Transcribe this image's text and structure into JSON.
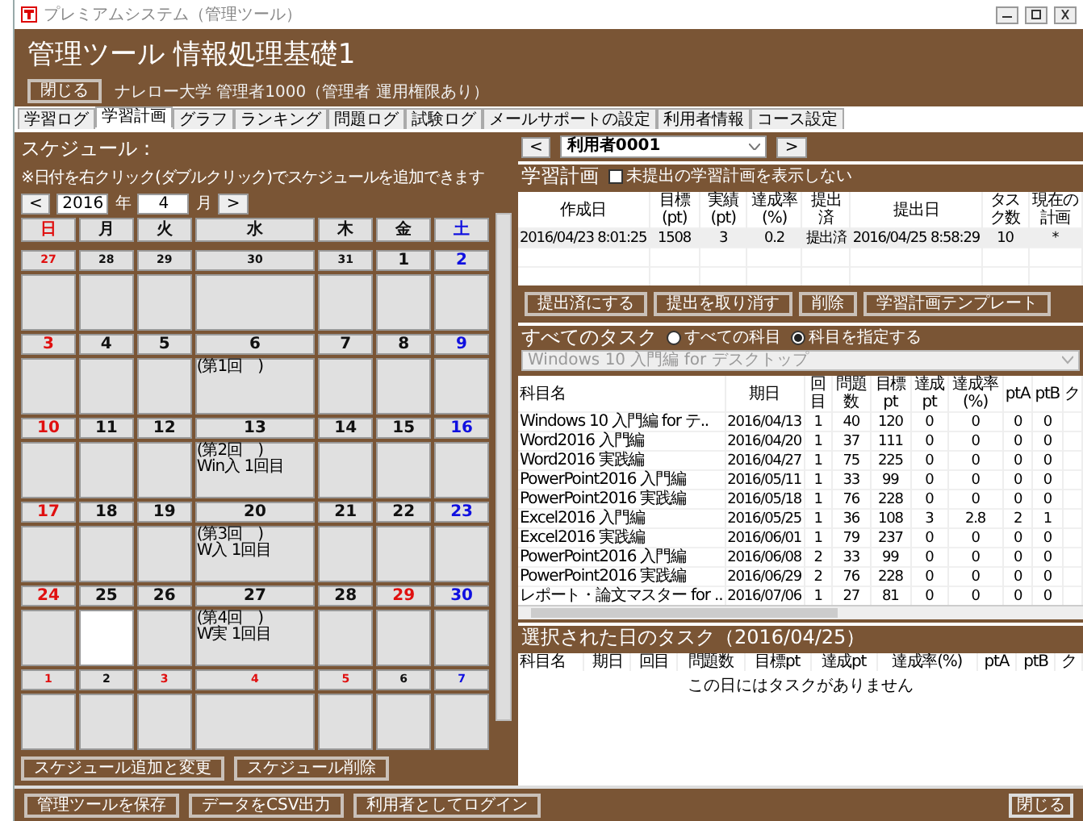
{
  "window": {
    "title": "プレミアムシステム（管理ツール）"
  },
  "header": {
    "title": "管理ツール 情報処理基礎1",
    "close_button": "閉じる",
    "user_info": "ナレロー大学 管理者1000（管理者 運用権限あり）"
  },
  "tabs": [
    {
      "label": "学習ログ",
      "selected": false
    },
    {
      "label": "学習計画",
      "selected": true
    },
    {
      "label": "グラフ",
      "selected": false
    },
    {
      "label": "ランキング",
      "selected": false
    },
    {
      "label": "問題ログ",
      "selected": false
    },
    {
      "label": "試験ログ",
      "selected": false
    },
    {
      "label": "メールサポートの設定",
      "selected": false
    },
    {
      "label": "利用者情報",
      "selected": false
    },
    {
      "label": "コース設定",
      "selected": false
    }
  ],
  "schedule": {
    "title": "スケジュール：",
    "hint": "※日付を右クリック(ダブルクリック)でスケジュールを追加できます",
    "prev": "<",
    "year": "2016",
    "year_unit": "年",
    "month": "4",
    "month_unit": "月",
    "next": ">",
    "weekdays": [
      {
        "label": "日",
        "kind": "sunday"
      },
      {
        "label": "月",
        "kind": "weekday"
      },
      {
        "label": "火",
        "kind": "weekday"
      },
      {
        "label": "水",
        "kind": "weekday"
      },
      {
        "label": "木",
        "kind": "weekday"
      },
      {
        "label": "金",
        "kind": "weekday"
      },
      {
        "label": "土",
        "kind": "saturday"
      }
    ],
    "weeks": [
      {
        "days": [
          {
            "label": "27",
            "kind": "sunday",
            "other_month": true,
            "selected": false
          },
          {
            "label": "28",
            "kind": "weekday",
            "other_month": true,
            "selected": false
          },
          {
            "label": "29",
            "kind": "weekday",
            "other_month": true,
            "selected": false
          },
          {
            "label": "30",
            "kind": "weekday",
            "other_month": true,
            "selected": false
          },
          {
            "label": "31",
            "kind": "weekday",
            "other_month": true,
            "selected": false
          },
          {
            "label": "1",
            "kind": "weekday",
            "other_month": false,
            "selected": false
          },
          {
            "label": "2",
            "kind": "saturday",
            "other_month": false,
            "selected": false
          }
        ]
      },
      {
        "days": [
          {
            "label": "3",
            "kind": "sunday",
            "other_month": false,
            "selected": false
          },
          {
            "label": "4",
            "kind": "weekday",
            "other_month": false,
            "selected": false
          },
          {
            "label": "5",
            "kind": "weekday",
            "other_month": false,
            "selected": false
          },
          {
            "label": "6",
            "kind": "weekday",
            "other_month": false,
            "selected": false,
            "entries": [
              "(第1回　)"
            ]
          },
          {
            "label": "7",
            "kind": "weekday",
            "other_month": false,
            "selected": false
          },
          {
            "label": "8",
            "kind": "weekday",
            "other_month": false,
            "selected": false
          },
          {
            "label": "9",
            "kind": "saturday",
            "other_month": false,
            "selected": false
          }
        ]
      },
      {
        "days": [
          {
            "label": "10",
            "kind": "sunday",
            "other_month": false,
            "selected": false
          },
          {
            "label": "11",
            "kind": "weekday",
            "other_month": false,
            "selected": false
          },
          {
            "label": "12",
            "kind": "weekday",
            "other_month": false,
            "selected": false
          },
          {
            "label": "13",
            "kind": "weekday",
            "other_month": false,
            "selected": false,
            "entries": [
              "(第2回　)",
              "Win入 1回目"
            ]
          },
          {
            "label": "14",
            "kind": "weekday",
            "other_month": false,
            "selected": false
          },
          {
            "label": "15",
            "kind": "weekday",
            "other_month": false,
            "selected": false
          },
          {
            "label": "16",
            "kind": "saturday",
            "other_month": false,
            "selected": false
          }
        ]
      },
      {
        "days": [
          {
            "label": "17",
            "kind": "sunday",
            "other_month": false,
            "selected": false
          },
          {
            "label": "18",
            "kind": "weekday",
            "other_month": false,
            "selected": false
          },
          {
            "label": "19",
            "kind": "weekday",
            "other_month": false,
            "selected": false
          },
          {
            "label": "20",
            "kind": "weekday",
            "other_month": false,
            "selected": false,
            "entries": [
              "(第3回　)",
              "W入 1回目"
            ]
          },
          {
            "label": "21",
            "kind": "weekday",
            "other_month": false,
            "selected": false
          },
          {
            "label": "22",
            "kind": "weekday",
            "other_month": false,
            "selected": false
          },
          {
            "label": "23",
            "kind": "saturday",
            "other_month": false,
            "selected": false
          }
        ]
      },
      {
        "days": [
          {
            "label": "24",
            "kind": "sunday",
            "other_month": false,
            "selected": false
          },
          {
            "label": "25",
            "kind": "weekday",
            "other_month": false,
            "selected": true
          },
          {
            "label": "26",
            "kind": "weekday",
            "other_month": false,
            "selected": false
          },
          {
            "label": "27",
            "kind": "weekday",
            "other_month": false,
            "selected": false,
            "entries": [
              "(第4回　)",
              "W実 1回目"
            ]
          },
          {
            "label": "28",
            "kind": "weekday",
            "other_month": false,
            "selected": false
          },
          {
            "label": "29",
            "kind": "holiday",
            "other_month": false,
            "selected": false
          },
          {
            "label": "30",
            "kind": "saturday",
            "other_month": false,
            "selected": false
          }
        ]
      },
      {
        "days": [
          {
            "label": "1",
            "kind": "sunday",
            "other_month": true,
            "selected": false
          },
          {
            "label": "2",
            "kind": "weekday",
            "other_month": true,
            "selected": false
          },
          {
            "label": "3",
            "kind": "holiday",
            "other_month": true,
            "selected": false
          },
          {
            "label": "4",
            "kind": "holiday",
            "other_month": true,
            "selected": false
          },
          {
            "label": "5",
            "kind": "holiday",
            "other_month": true,
            "selected": false
          },
          {
            "label": "6",
            "kind": "weekday",
            "other_month": true,
            "selected": false
          },
          {
            "label": "7",
            "kind": "saturday",
            "other_month": true,
            "selected": false
          }
        ]
      }
    ],
    "buttons": [
      "スケジュール追加と変更",
      "スケジュール削除"
    ]
  },
  "user_picker": {
    "prev": "<",
    "value": "利用者0001",
    "next": ">"
  },
  "plan": {
    "title": "学習計画",
    "filter": {
      "label": "未提出の学習計画を表示しない",
      "checked": false
    },
    "columns": [
      "作成日",
      "目標(pt)",
      "実績(pt)",
      "達成率(%)",
      "提出済",
      "提出日",
      "タスク数",
      "現在の計画"
    ],
    "rows": [
      [
        "2016/04/23 8:01:25",
        "1508",
        "3",
        "0.2",
        "提出済",
        "2016/04/25 8:58:29",
        "10",
        "*"
      ]
    ],
    "buttons": [
      "提出済にする",
      "提出を取り消す",
      "削除",
      "学習計画テンプレート"
    ]
  },
  "tasks": {
    "title": "すべてのタスク",
    "scope": [
      {
        "label": "すべての科目",
        "selected": false
      },
      {
        "label": "科目を指定する",
        "selected": true
      }
    ],
    "subject": {
      "value": "Windows 10 入門編 for デスクトップ"
    },
    "columns": [
      "科目名",
      "期日",
      "回目",
      "問題数",
      "目標pt",
      "達成pt",
      "達成率(%)",
      "ptA",
      "ptB",
      "ク"
    ],
    "rows": [
      [
        "Windows 10 入門編 for テ..",
        "2016/04/13",
        "1",
        "40",
        "120",
        "0",
        "0",
        "0",
        "0"
      ],
      [
        "Word2016 入門編",
        "2016/04/20",
        "1",
        "37",
        "111",
        "0",
        "0",
        "0",
        "0"
      ],
      [
        "Word2016 実践編",
        "2016/04/27",
        "1",
        "75",
        "225",
        "0",
        "0",
        "0",
        "0"
      ],
      [
        "PowerPoint2016 入門編",
        "2016/05/11",
        "1",
        "33",
        "99",
        "0",
        "0",
        "0",
        "0"
      ],
      [
        "PowerPoint2016 実践編",
        "2016/05/18",
        "1",
        "76",
        "228",
        "0",
        "0",
        "0",
        "0"
      ],
      [
        "Excel2016 入門編",
        "2016/05/25",
        "1",
        "36",
        "108",
        "3",
        "2.8",
        "2",
        "1"
      ],
      [
        "Excel2016 実践編",
        "2016/06/01",
        "1",
        "79",
        "237",
        "0",
        "0",
        "0",
        "0"
      ],
      [
        "PowerPoint2016 入門編",
        "2016/06/08",
        "2",
        "33",
        "99",
        "0",
        "0",
        "0",
        "0"
      ],
      [
        "PowerPoint2016 実践編",
        "2016/06/29",
        "2",
        "76",
        "228",
        "0",
        "0",
        "0",
        "0"
      ],
      [
        "レポート・論文マスター for ..",
        "2016/07/06",
        "1",
        "27",
        "81",
        "0",
        "0",
        "0",
        "0"
      ]
    ]
  },
  "day_tasks": {
    "title": "選択された日のタスク（2016/04/25）",
    "columns": [
      "科目名",
      "期日",
      "回目",
      "問題数",
      "目標pt",
      "達成pt",
      "達成率(%)",
      "ptA",
      "ptB",
      "ク"
    ],
    "empty_message": "この日にはタスクがありません"
  },
  "footer": {
    "buttons": [
      "管理ツールを保存",
      "データをCSV出力",
      "利用者としてログイン"
    ],
    "close_button": "閉じる"
  }
}
